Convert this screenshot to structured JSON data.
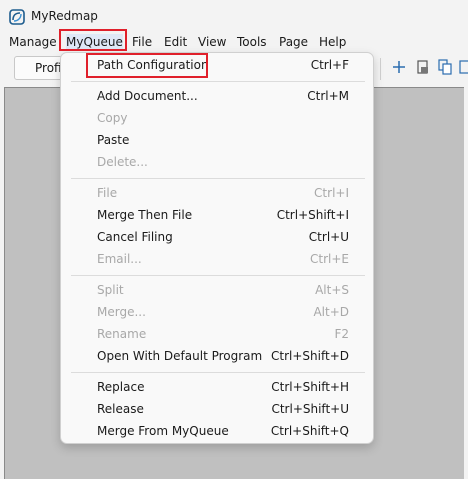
{
  "window": {
    "title": "MyRedmap",
    "app_icon": "redmap-logo-icon"
  },
  "menubar": {
    "items": [
      {
        "label": "Manage",
        "key": "M"
      },
      {
        "label": "MyQueue",
        "key": "y",
        "active": true
      },
      {
        "label": "File",
        "key": "F"
      },
      {
        "label": "Edit",
        "key": "E"
      },
      {
        "label": "View",
        "key": "V"
      },
      {
        "label": "Tools",
        "key": "T"
      },
      {
        "label": "Page",
        "key": "P"
      },
      {
        "label": "Help",
        "key": "H"
      }
    ]
  },
  "toolbar": {
    "profile_button_label": "Profi",
    "icons": [
      "plus-icon",
      "document-stamp-icon",
      "copy-document-icon",
      "document-icon"
    ]
  },
  "myqueue_menu": {
    "groups": [
      [
        {
          "label": "Path Configuration",
          "shortcut": "Ctrl+F",
          "enabled": true,
          "highlighted": true
        }
      ],
      [
        {
          "label": "Add Document...",
          "shortcut": "Ctrl+M",
          "enabled": true
        },
        {
          "label": "Copy",
          "shortcut": "",
          "enabled": false
        },
        {
          "label": "Paste",
          "shortcut": "",
          "enabled": true
        },
        {
          "label": "Delete...",
          "shortcut": "",
          "enabled": false
        }
      ],
      [
        {
          "label": "File",
          "shortcut": "Ctrl+I",
          "enabled": false
        },
        {
          "label": "Merge Then File",
          "shortcut": "Ctrl+Shift+I",
          "enabled": true
        },
        {
          "label": "Cancel Filing",
          "shortcut": "Ctrl+U",
          "enabled": true
        },
        {
          "label": "Email...",
          "shortcut": "Ctrl+E",
          "enabled": false
        }
      ],
      [
        {
          "label": "Split",
          "shortcut": "Alt+S",
          "enabled": false
        },
        {
          "label": "Merge...",
          "shortcut": "Alt+D",
          "enabled": false
        },
        {
          "label": "Rename",
          "shortcut": "F2",
          "enabled": false
        },
        {
          "label": "Open With Default Program",
          "shortcut": "Ctrl+Shift+D",
          "enabled": true
        }
      ],
      [
        {
          "label": "Replace",
          "shortcut": "Ctrl+Shift+H",
          "enabled": true
        },
        {
          "label": "Release",
          "shortcut": "Ctrl+Shift+U",
          "enabled": true
        },
        {
          "label": "Merge From MyQueue",
          "shortcut": "Ctrl+Shift+Q",
          "enabled": true
        }
      ]
    ]
  },
  "colors": {
    "highlight_box": "#e0202b",
    "menu_active_bg": "#dfe8f6",
    "workspace_bg": "#c0c0c0",
    "disabled_text": "#a8a8a8",
    "toolbar_icon": "#2b6cb0"
  }
}
